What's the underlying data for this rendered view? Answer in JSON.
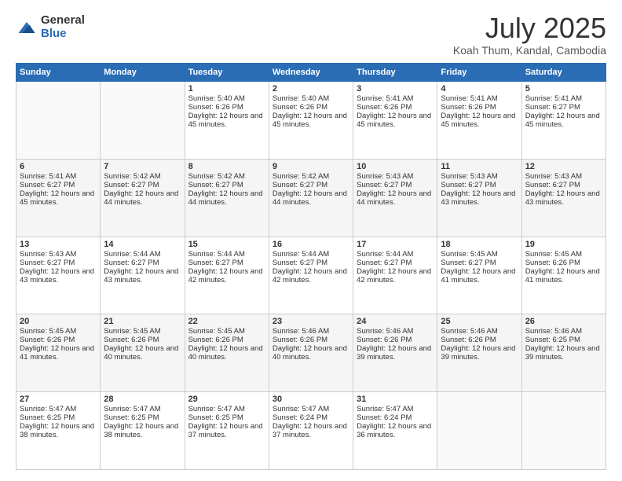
{
  "logo": {
    "general": "General",
    "blue": "Blue"
  },
  "header": {
    "month": "July 2025",
    "location": "Koah Thum, Kandal, Cambodia"
  },
  "weekdays": [
    "Sunday",
    "Monday",
    "Tuesday",
    "Wednesday",
    "Thursday",
    "Friday",
    "Saturday"
  ],
  "weeks": [
    [
      {
        "day": "",
        "sunrise": "",
        "sunset": "",
        "daylight": ""
      },
      {
        "day": "",
        "sunrise": "",
        "sunset": "",
        "daylight": ""
      },
      {
        "day": "1",
        "sunrise": "Sunrise: 5:40 AM",
        "sunset": "Sunset: 6:26 PM",
        "daylight": "Daylight: 12 hours and 45 minutes."
      },
      {
        "day": "2",
        "sunrise": "Sunrise: 5:40 AM",
        "sunset": "Sunset: 6:26 PM",
        "daylight": "Daylight: 12 hours and 45 minutes."
      },
      {
        "day": "3",
        "sunrise": "Sunrise: 5:41 AM",
        "sunset": "Sunset: 6:26 PM",
        "daylight": "Daylight: 12 hours and 45 minutes."
      },
      {
        "day": "4",
        "sunrise": "Sunrise: 5:41 AM",
        "sunset": "Sunset: 6:26 PM",
        "daylight": "Daylight: 12 hours and 45 minutes."
      },
      {
        "day": "5",
        "sunrise": "Sunrise: 5:41 AM",
        "sunset": "Sunset: 6:27 PM",
        "daylight": "Daylight: 12 hours and 45 minutes."
      }
    ],
    [
      {
        "day": "6",
        "sunrise": "Sunrise: 5:41 AM",
        "sunset": "Sunset: 6:27 PM",
        "daylight": "Daylight: 12 hours and 45 minutes."
      },
      {
        "day": "7",
        "sunrise": "Sunrise: 5:42 AM",
        "sunset": "Sunset: 6:27 PM",
        "daylight": "Daylight: 12 hours and 44 minutes."
      },
      {
        "day": "8",
        "sunrise": "Sunrise: 5:42 AM",
        "sunset": "Sunset: 6:27 PM",
        "daylight": "Daylight: 12 hours and 44 minutes."
      },
      {
        "day": "9",
        "sunrise": "Sunrise: 5:42 AM",
        "sunset": "Sunset: 6:27 PM",
        "daylight": "Daylight: 12 hours and 44 minutes."
      },
      {
        "day": "10",
        "sunrise": "Sunrise: 5:43 AM",
        "sunset": "Sunset: 6:27 PM",
        "daylight": "Daylight: 12 hours and 44 minutes."
      },
      {
        "day": "11",
        "sunrise": "Sunrise: 5:43 AM",
        "sunset": "Sunset: 6:27 PM",
        "daylight": "Daylight: 12 hours and 43 minutes."
      },
      {
        "day": "12",
        "sunrise": "Sunrise: 5:43 AM",
        "sunset": "Sunset: 6:27 PM",
        "daylight": "Daylight: 12 hours and 43 minutes."
      }
    ],
    [
      {
        "day": "13",
        "sunrise": "Sunrise: 5:43 AM",
        "sunset": "Sunset: 6:27 PM",
        "daylight": "Daylight: 12 hours and 43 minutes."
      },
      {
        "day": "14",
        "sunrise": "Sunrise: 5:44 AM",
        "sunset": "Sunset: 6:27 PM",
        "daylight": "Daylight: 12 hours and 43 minutes."
      },
      {
        "day": "15",
        "sunrise": "Sunrise: 5:44 AM",
        "sunset": "Sunset: 6:27 PM",
        "daylight": "Daylight: 12 hours and 42 minutes."
      },
      {
        "day": "16",
        "sunrise": "Sunrise: 5:44 AM",
        "sunset": "Sunset: 6:27 PM",
        "daylight": "Daylight: 12 hours and 42 minutes."
      },
      {
        "day": "17",
        "sunrise": "Sunrise: 5:44 AM",
        "sunset": "Sunset: 6:27 PM",
        "daylight": "Daylight: 12 hours and 42 minutes."
      },
      {
        "day": "18",
        "sunrise": "Sunrise: 5:45 AM",
        "sunset": "Sunset: 6:27 PM",
        "daylight": "Daylight: 12 hours and 41 minutes."
      },
      {
        "day": "19",
        "sunrise": "Sunrise: 5:45 AM",
        "sunset": "Sunset: 6:26 PM",
        "daylight": "Daylight: 12 hours and 41 minutes."
      }
    ],
    [
      {
        "day": "20",
        "sunrise": "Sunrise: 5:45 AM",
        "sunset": "Sunset: 6:26 PM",
        "daylight": "Daylight: 12 hours and 41 minutes."
      },
      {
        "day": "21",
        "sunrise": "Sunrise: 5:45 AM",
        "sunset": "Sunset: 6:26 PM",
        "daylight": "Daylight: 12 hours and 40 minutes."
      },
      {
        "day": "22",
        "sunrise": "Sunrise: 5:45 AM",
        "sunset": "Sunset: 6:26 PM",
        "daylight": "Daylight: 12 hours and 40 minutes."
      },
      {
        "day": "23",
        "sunrise": "Sunrise: 5:46 AM",
        "sunset": "Sunset: 6:26 PM",
        "daylight": "Daylight: 12 hours and 40 minutes."
      },
      {
        "day": "24",
        "sunrise": "Sunrise: 5:46 AM",
        "sunset": "Sunset: 6:26 PM",
        "daylight": "Daylight: 12 hours and 39 minutes."
      },
      {
        "day": "25",
        "sunrise": "Sunrise: 5:46 AM",
        "sunset": "Sunset: 6:26 PM",
        "daylight": "Daylight: 12 hours and 39 minutes."
      },
      {
        "day": "26",
        "sunrise": "Sunrise: 5:46 AM",
        "sunset": "Sunset: 6:25 PM",
        "daylight": "Daylight: 12 hours and 39 minutes."
      }
    ],
    [
      {
        "day": "27",
        "sunrise": "Sunrise: 5:47 AM",
        "sunset": "Sunset: 6:25 PM",
        "daylight": "Daylight: 12 hours and 38 minutes."
      },
      {
        "day": "28",
        "sunrise": "Sunrise: 5:47 AM",
        "sunset": "Sunset: 6:25 PM",
        "daylight": "Daylight: 12 hours and 38 minutes."
      },
      {
        "day": "29",
        "sunrise": "Sunrise: 5:47 AM",
        "sunset": "Sunset: 6:25 PM",
        "daylight": "Daylight: 12 hours and 37 minutes."
      },
      {
        "day": "30",
        "sunrise": "Sunrise: 5:47 AM",
        "sunset": "Sunset: 6:24 PM",
        "daylight": "Daylight: 12 hours and 37 minutes."
      },
      {
        "day": "31",
        "sunrise": "Sunrise: 5:47 AM",
        "sunset": "Sunset: 6:24 PM",
        "daylight": "Daylight: 12 hours and 36 minutes."
      },
      {
        "day": "",
        "sunrise": "",
        "sunset": "",
        "daylight": ""
      },
      {
        "day": "",
        "sunrise": "",
        "sunset": "",
        "daylight": ""
      }
    ]
  ]
}
